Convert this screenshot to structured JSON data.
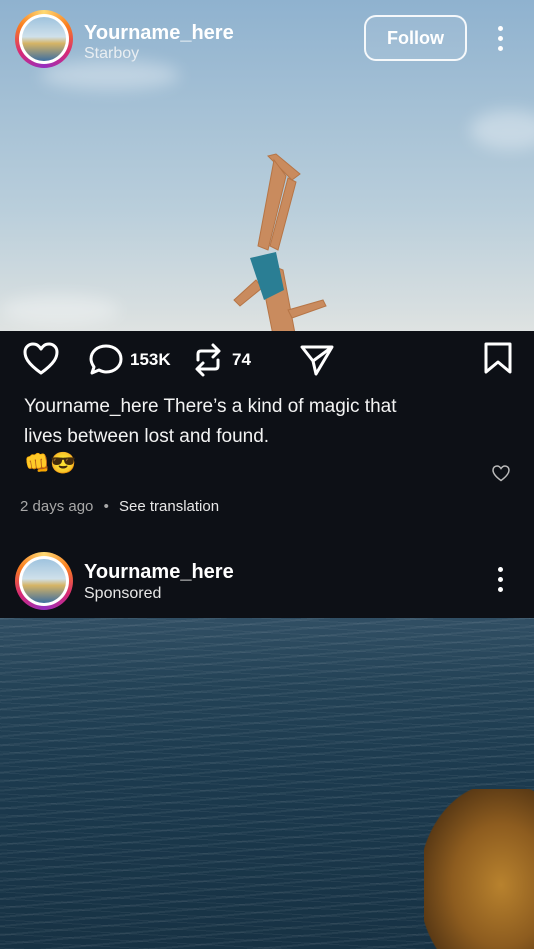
{
  "post": {
    "username": "Yourname_here",
    "subtitle": "Starboy",
    "follow_label": "Follow",
    "more_icon": "more-vertical-icon"
  },
  "actions": {
    "like_icon": "heart-icon",
    "comment_icon": "comment-icon",
    "comment_count": "153K",
    "repost_icon": "repost-icon",
    "repost_count": "74",
    "share_icon": "send-icon",
    "save_icon": "bookmark-icon"
  },
  "caption": {
    "username": "Yourname_here",
    "text": " There’s a kind of magic that lives between lost and found.",
    "emojis": "👊😎",
    "time": "2 days ago",
    "separator": "•",
    "translate_label": "See translation"
  },
  "next_post": {
    "username": "Yourname_here",
    "subtitle": "Sponsored"
  },
  "colors": {
    "panel": "#0d1016",
    "meta_text": "#a8a8a8"
  }
}
